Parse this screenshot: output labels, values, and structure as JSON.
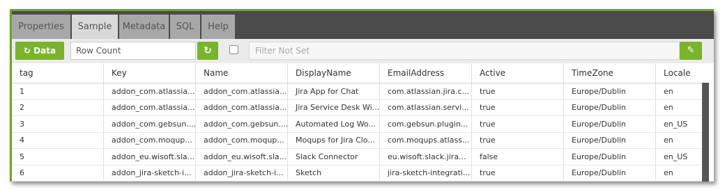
{
  "tabs": [
    {
      "label": "Properties"
    },
    {
      "label": "Sample"
    },
    {
      "label": "Metadata"
    },
    {
      "label": "SQL"
    },
    {
      "label": "Help"
    }
  ],
  "toolbar": {
    "data_button_label": "Data",
    "refresh_icon": "refresh-icon",
    "row_count_placeholder": "Row Count",
    "filter_placeholder": "Filter Not Set",
    "edit_icon": "pencil-icon",
    "accent_color": "#7ab32e"
  },
  "table": {
    "columns": [
      "tag",
      "Key",
      "Name",
      "DisplayName",
      "EmailAddress",
      "Active",
      "TimeZone",
      "Locale"
    ],
    "rows": [
      [
        "1",
        "addon_com.atlassia...",
        "addon_com.atlassia...",
        "Jira App for Chat",
        "com.atlassian.jira.c...",
        "true",
        "Europe/Dublin",
        "en"
      ],
      [
        "2",
        "addon_com.atlassia...",
        "addon_com.atlassia...",
        "Jira Service Desk Wi...",
        "com.atlassian.servi...",
        "true",
        "Europe/Dublin",
        "en"
      ],
      [
        "3",
        "addon_com.gebsun....",
        "addon_com.gebsun....",
        "Automated Log Wo...",
        "com.gebsun.plugin...",
        "true",
        "Europe/Dublin",
        "en_US"
      ],
      [
        "4",
        "addon_com.moqup...",
        "addon_com.moqup...",
        "Moqups for Jira Clo...",
        "com.moqups.atlass...",
        "true",
        "Europe/Dublin",
        "en"
      ],
      [
        "5",
        "addon_eu.wisoft.sla...",
        "addon_eu.wisoft.sla...",
        "Slack Connector",
        "eu.wisoft.slack.jira...",
        "false",
        "Europe/Dublin",
        "en_US"
      ],
      [
        "6",
        "addon_jira-sketch-i...",
        "addon_jira-sketch-i...",
        "Sketch",
        "jira-sketch-integrati...",
        "true",
        "Europe/Dublin",
        "en"
      ]
    ]
  }
}
